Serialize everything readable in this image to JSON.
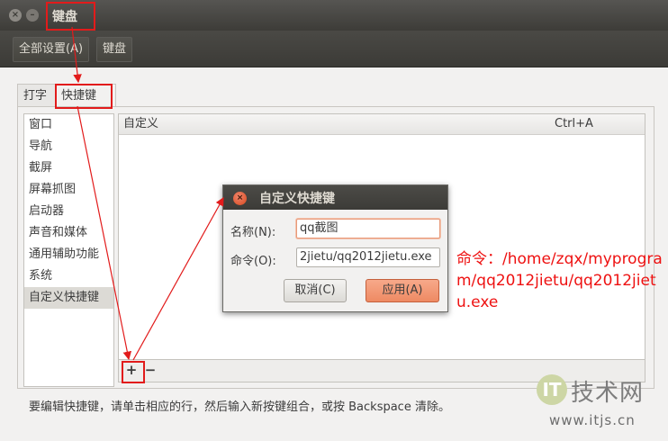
{
  "window": {
    "title": "键盘"
  },
  "menubar": {
    "all_settings": "全部设置(A)",
    "current": "键盘"
  },
  "tabs": [
    {
      "label": "打字"
    },
    {
      "label": "快捷键"
    }
  ],
  "categories": [
    "窗口",
    "导航",
    "截屏",
    "屏幕抓图",
    "启动器",
    "声音和媒体",
    "通用辅助功能",
    "系统",
    "自定义快捷键"
  ],
  "selected_category": "自定义快捷键",
  "shortcuts_table": {
    "col_name": "自定义",
    "col_key": "Ctrl+A"
  },
  "toolbar": {
    "add": "+",
    "remove": "−"
  },
  "hint": "要编辑快捷键，请单击相应的行，然后输入新按键组合，或按 Backspace 清除。",
  "dialog": {
    "title": "自定义快捷键",
    "name_label": "名称(N):",
    "name_value": "qq截图",
    "command_label": "命令(O):",
    "command_value": "2jietu/qq2012jietu.exe",
    "cancel": "取消(C)",
    "apply": "应用(A)"
  },
  "annotation": {
    "text": "命令：/home/zqx/myprogram/qq2012jietu/qq2012jietu.exe",
    "color": "#ee1111"
  },
  "watermark": {
    "logo": "IT",
    "name": "技术网",
    "url": "www.itjs.cn"
  },
  "colors": {
    "highlight": "#e21b1b",
    "apply_button": "#ee8a63",
    "titlebar": "#3d3c38"
  }
}
